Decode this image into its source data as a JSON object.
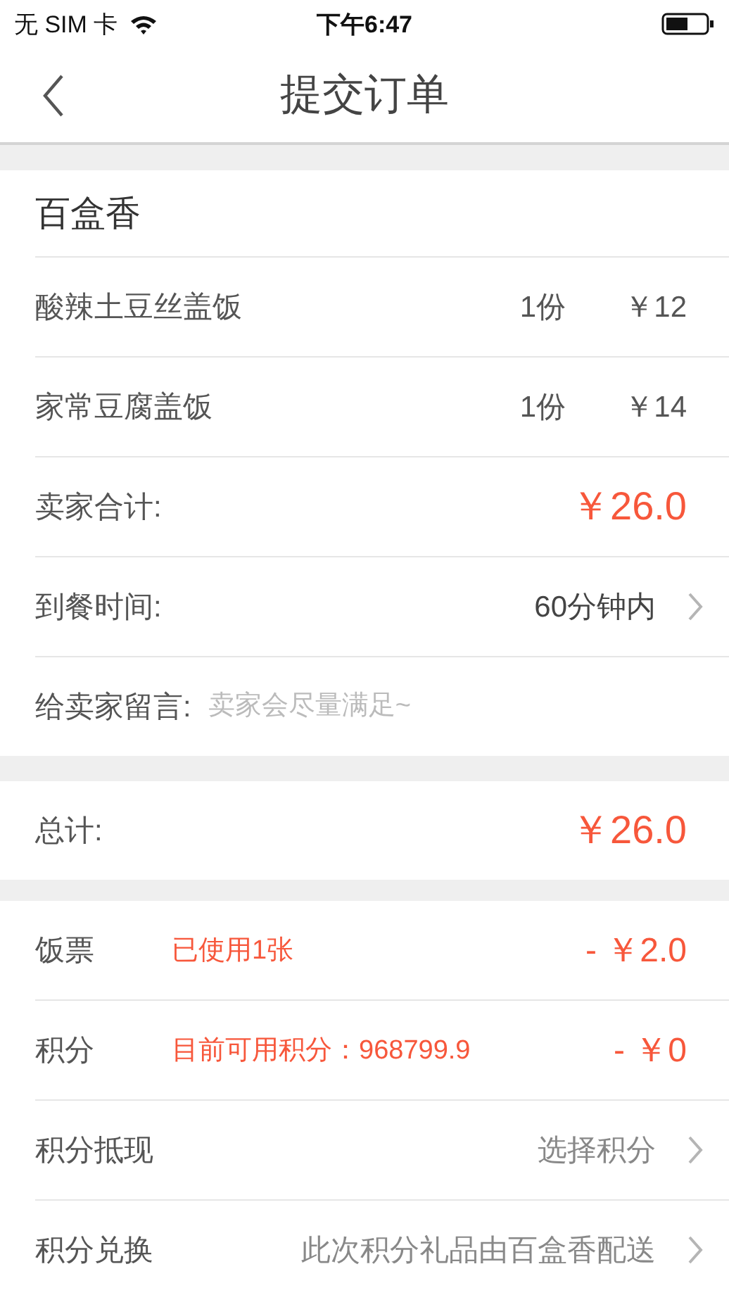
{
  "status_bar": {
    "carrier": "无 SIM 卡",
    "time": "下午6:47"
  },
  "nav": {
    "title": "提交订单"
  },
  "shop": {
    "name": "百盒香",
    "items": [
      {
        "name": "酸辣土豆丝盖饭",
        "qty": "1份",
        "price": "￥12"
      },
      {
        "name": "家常豆腐盖饭",
        "qty": "1份",
        "price": "￥14"
      }
    ]
  },
  "seller_total": {
    "label": "卖家合计:",
    "amount": "￥26.0"
  },
  "delivery_time": {
    "label": "到餐时间:",
    "value": "60分钟内"
  },
  "message": {
    "label": "给卖家留言:",
    "placeholder": "卖家会尽量满足~"
  },
  "total": {
    "label": "总计:",
    "amount": "￥26.0"
  },
  "discounts": [
    {
      "kind": "deduction",
      "label": "饭票",
      "note": "已使用1张",
      "amount": "- ￥2.0"
    },
    {
      "kind": "deduction",
      "label": "积分",
      "note": "目前可用积分：968799.9",
      "amount": "- ￥0"
    },
    {
      "kind": "link",
      "label": "积分抵现",
      "value": "选择积分"
    },
    {
      "kind": "link",
      "label": "积分兑换",
      "value": "此次积分礼品由百盒香配送"
    }
  ]
}
